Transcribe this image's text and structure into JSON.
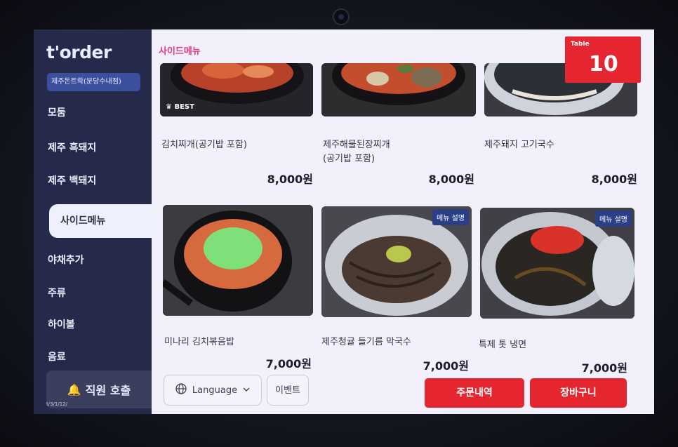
{
  "sidebar": {
    "logo": "t'order",
    "store_name": "제주돈트락(분당수내점)",
    "items": [
      {
        "label": "모둠"
      },
      {
        "label": "제주 흑돼지"
      },
      {
        "label": "제주 백돼지"
      },
      {
        "label": "사이드메뉴"
      },
      {
        "label": "야채추가"
      },
      {
        "label": "주류"
      },
      {
        "label": "하이볼"
      },
      {
        "label": "음료"
      }
    ],
    "staff_call": "직원 호출",
    "footer_text": "t/3/1/12/"
  },
  "main": {
    "section_title": "사이드메뉴",
    "table": {
      "label": "Table",
      "number": "10"
    },
    "cards": [
      {
        "name": "김치찌개(공기밥 포함)",
        "price": "8,000원",
        "badge": "BEST"
      },
      {
        "name": "제주해물된장찌개\n(공기밥 포함)",
        "price": "8,000원"
      },
      {
        "name": "제주돼지 고기국수",
        "price": "8,000원"
      },
      {
        "name": "미나리 김치볶음밥",
        "price": "7,000원"
      },
      {
        "name": "제주청귤 들기름 막국수",
        "price": "7,000원",
        "desc_badge": "메뉴 설명"
      },
      {
        "name": "특제 톳 냉면",
        "price": "7,000원",
        "desc_badge": "메뉴 설명"
      }
    ]
  },
  "bottom": {
    "language_label": "Language",
    "event_label": "이벤트",
    "order_history_label": "주문내역",
    "cart_label": "장바구니"
  },
  "colors": {
    "sidebar_bg": "#262a4a",
    "accent_red": "#e5252f",
    "section_pink": "#e6398a",
    "store_badge": "#3b4f9d"
  }
}
